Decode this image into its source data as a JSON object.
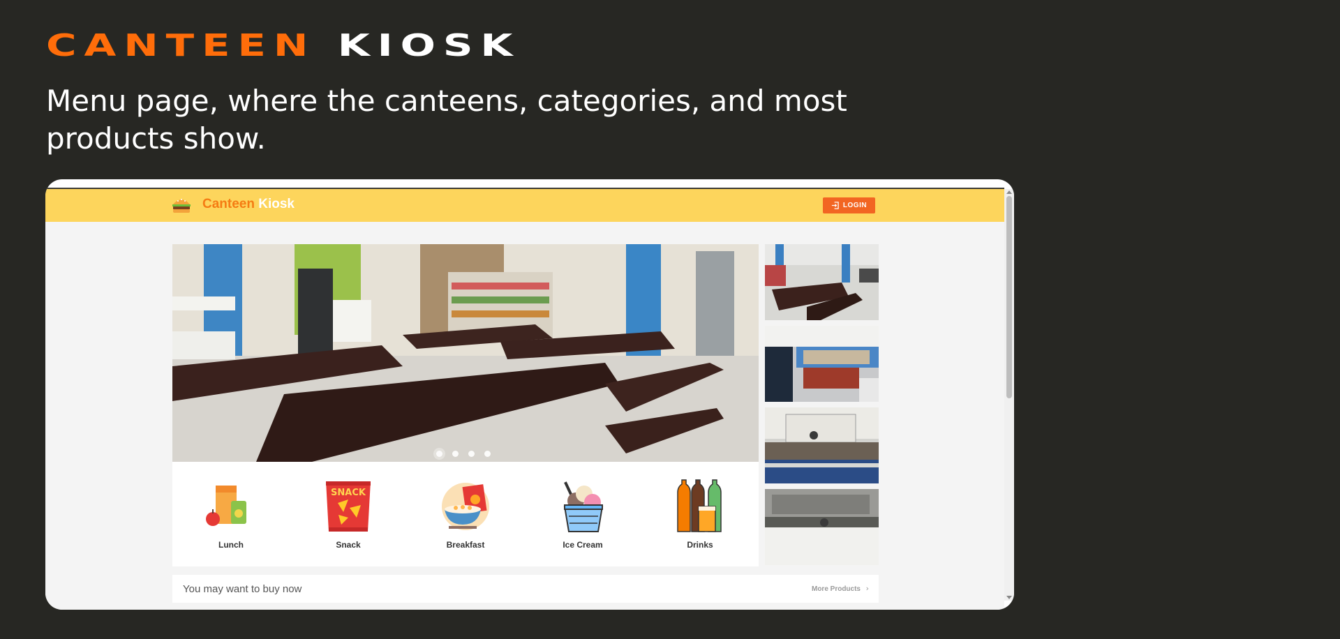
{
  "hero": {
    "brand_word1": "CANTEEN",
    "brand_word2": "KIOSK",
    "caption": "Menu page, where the canteens, categories, and most products show."
  },
  "app": {
    "logo_word1": "Canteen",
    "logo_word2": "Kiosk",
    "login_label": "LOGIN"
  },
  "carousel": {
    "slides": 4,
    "active_index": 0
  },
  "categories": [
    {
      "label": "Lunch",
      "icon": "lunch-icon"
    },
    {
      "label": "Snack",
      "icon": "snack-icon"
    },
    {
      "label": "Breakfast",
      "icon": "breakfast-icon"
    },
    {
      "label": "Ice Cream",
      "icon": "ice-cream-icon"
    },
    {
      "label": "Drinks",
      "icon": "drinks-icon"
    }
  ],
  "snack_bag_text": "SNACK",
  "suggest": {
    "title": "You may want to buy now",
    "more_label": "More Products"
  },
  "colors": {
    "background": "#272723",
    "brand_orange": "#ff6d0a",
    "appbar_yellow": "#fdd55c",
    "login_orange": "#f26522"
  }
}
